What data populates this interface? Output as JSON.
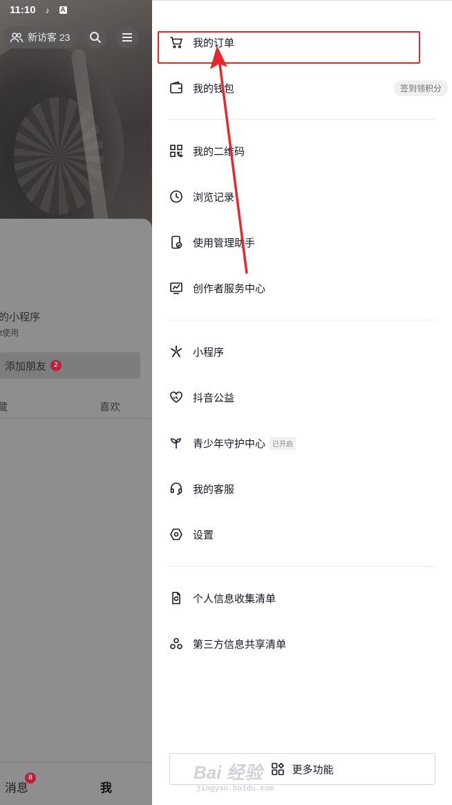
{
  "status_bar": {
    "time": "11:10"
  },
  "profile": {
    "visitor_label": "新访客 23",
    "mini_program_title": "的小程序",
    "mini_program_sub": "t使用",
    "add_friend_label": "添加朋友",
    "add_friend_badge": "2",
    "tab_left": "藏",
    "tab_likes": "喜欢"
  },
  "bottom_nav": {
    "messages": "消息",
    "messages_badge": "8",
    "me": "我"
  },
  "drawer": {
    "group1": [
      {
        "label": "我的订单",
        "icon": "cart-icon"
      },
      {
        "label": "我的钱包",
        "icon": "wallet-icon",
        "pill": "签到领积分"
      }
    ],
    "group2": [
      {
        "label": "我的二维码",
        "icon": "qr-code-icon"
      },
      {
        "label": "浏览记录",
        "icon": "clock-icon"
      },
      {
        "label": "使用管理助手",
        "icon": "phone-check-icon"
      },
      {
        "label": "创作者服务中心",
        "icon": "chart-monitor-icon"
      }
    ],
    "group3": [
      {
        "label": "小程序",
        "icon": "mini-program-icon"
      },
      {
        "label": "抖音公益",
        "icon": "heart-hands-icon"
      },
      {
        "label": "青少年守护中心",
        "icon": "sprout-icon",
        "tag": "已开启"
      },
      {
        "label": "我的客服",
        "icon": "headset-icon"
      },
      {
        "label": "设置",
        "icon": "settings-hex-icon"
      }
    ],
    "group4": [
      {
        "label": "个人信息收集清单",
        "icon": "document-refresh-icon"
      },
      {
        "label": "第三方信息共享清单",
        "icon": "share-circles-icon"
      }
    ],
    "more_button": "更多功能"
  },
  "watermark": {
    "brand": "Bai 经验",
    "url": "jingyan.baidu.com"
  },
  "colors": {
    "highlight": "#e8262a",
    "badge": "#b8233a",
    "text": "#161823"
  }
}
